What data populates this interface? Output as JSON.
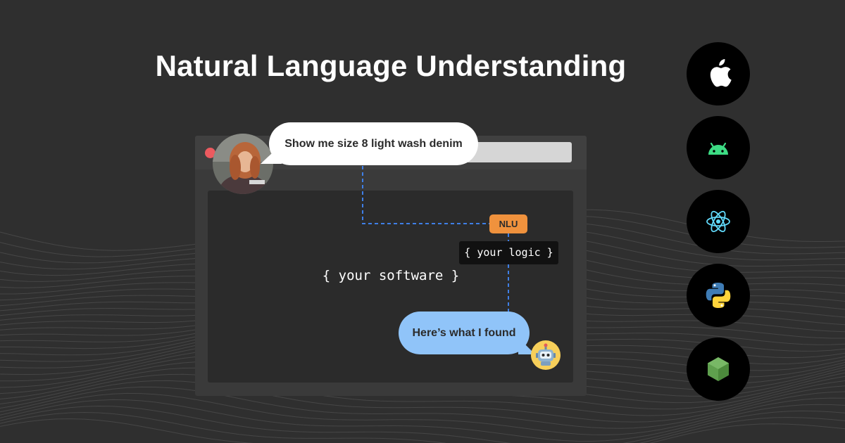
{
  "page": {
    "title": "Natural Language Understanding"
  },
  "chat": {
    "user_message": "Show me size 8 light wash denim",
    "bot_message": "Here’s what I found"
  },
  "diagram": {
    "nlu_label": "NLU",
    "logic_label": "{ your logic }",
    "software_label": "{ your software }"
  },
  "platforms": [
    {
      "name": "apple-icon"
    },
    {
      "name": "android-icon"
    },
    {
      "name": "react-icon"
    },
    {
      "name": "python-icon"
    },
    {
      "name": "nodejs-icon"
    }
  ],
  "colors": {
    "background": "#2f2f2f",
    "nlu_badge": "#f0923d",
    "bot_bubble": "#90c4f9",
    "connector": "#3f7fe6",
    "android_green": "#3ddc84",
    "react_blue": "#61dafb",
    "python_blue": "#3f7cb5",
    "python_yellow": "#ffd43b",
    "node_green": "#5fa04e"
  }
}
